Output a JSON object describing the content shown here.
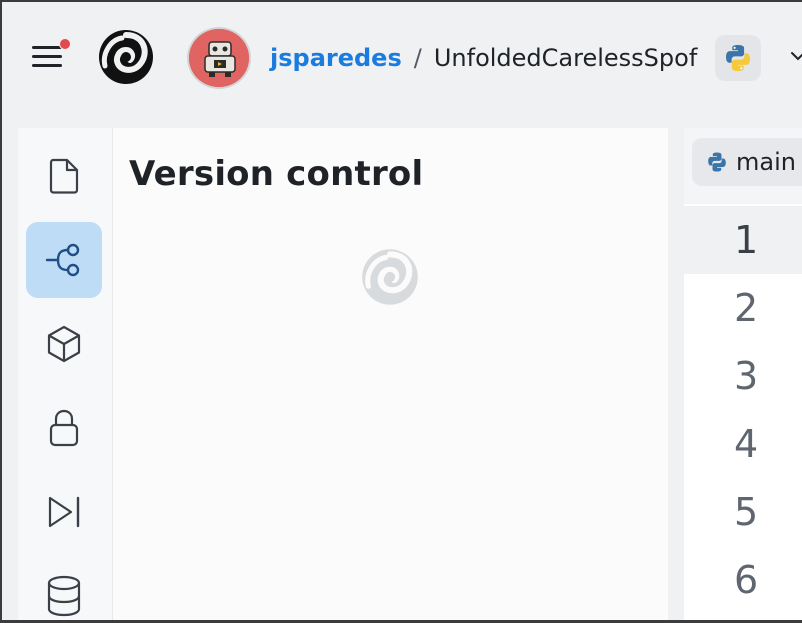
{
  "topbar": {
    "username": "jsparedes",
    "separator": "/",
    "repl_name": "UnfoldedCarelessSpof",
    "notification_color": "#e5484d",
    "language_icon": "python-icon"
  },
  "rail": {
    "items": [
      {
        "icon": "file-icon",
        "active": false
      },
      {
        "icon": "git-branch-icon",
        "active": true
      },
      {
        "icon": "package-cube-icon",
        "active": false
      },
      {
        "icon": "lock-icon",
        "active": false
      },
      {
        "icon": "run-step-icon",
        "active": false
      },
      {
        "icon": "database-icon",
        "active": false
      }
    ],
    "active_color": "#bfdcf7"
  },
  "panel": {
    "title": "Version control",
    "loading": true
  },
  "editor": {
    "tab_label": "main",
    "line_numbers": [
      "1",
      "2",
      "3",
      "4",
      "5",
      "6"
    ],
    "current_line": "1"
  }
}
